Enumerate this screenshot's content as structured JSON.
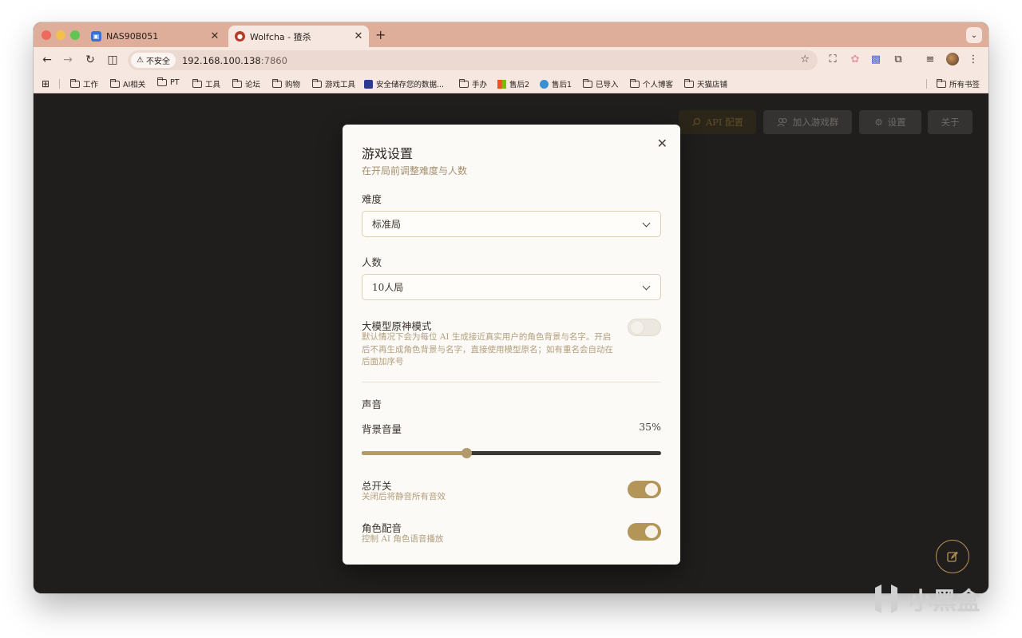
{
  "tabs": [
    {
      "title": "NAS90B051",
      "active": false
    },
    {
      "title": "Wolfcha - 猹杀",
      "active": true
    }
  ],
  "toolbar": {
    "security_label": "不安全",
    "url_host": "192.168.100.138",
    "url_port": ":7860"
  },
  "bookmarks": [
    {
      "label": "工作",
      "type": "folder"
    },
    {
      "label": "AI相关",
      "type": "folder"
    },
    {
      "label": "PT",
      "type": "folder"
    },
    {
      "label": "工具",
      "type": "folder"
    },
    {
      "label": "论坛",
      "type": "folder"
    },
    {
      "label": "购物",
      "type": "folder"
    },
    {
      "label": "游戏工具",
      "type": "folder"
    },
    {
      "label": "安全储存您的数据...",
      "type": "site"
    },
    {
      "label": "手办",
      "type": "folder"
    },
    {
      "label": "售后2",
      "type": "site"
    },
    {
      "label": "售后1",
      "type": "site"
    },
    {
      "label": "已导入",
      "type": "folder"
    },
    {
      "label": "个人博客",
      "type": "folder"
    },
    {
      "label": "天猫店铺",
      "type": "folder"
    },
    {
      "label": "所有书签",
      "type": "folder"
    }
  ],
  "page": {
    "buttons": {
      "api": "API 配置",
      "join": "加入游戏群",
      "settings": "设置",
      "about": "关于"
    }
  },
  "modal": {
    "title": "游戏设置",
    "subtitle": "在开局前调整难度与人数",
    "difficulty_label": "难度",
    "difficulty_value": "标准局",
    "players_label": "人数",
    "players_value": "10人局",
    "genshin_label": "大模型原神模式",
    "genshin_desc": "默认情况下会为每位 AI 生成接近真实用户的角色背景与名字。开启后不再生成角色背景与名字，直接使用模型原名；如有重名会自动在后面加序号",
    "genshin_enabled": false,
    "sound_section": "声音",
    "bg_volume_label": "背景音量",
    "bg_volume_value": "35%",
    "bg_volume_fraction": 0.35,
    "master_label": "总开关",
    "master_desc": "关闭后将静音所有音效",
    "master_enabled": true,
    "voice_label": "角色配音",
    "voice_desc": "控制 AI 角色语音播放",
    "voice_enabled": true
  },
  "colors": {
    "accent": "#b39558",
    "page_bg": "#1f1e1d",
    "tabstrip": "#deae9a"
  }
}
